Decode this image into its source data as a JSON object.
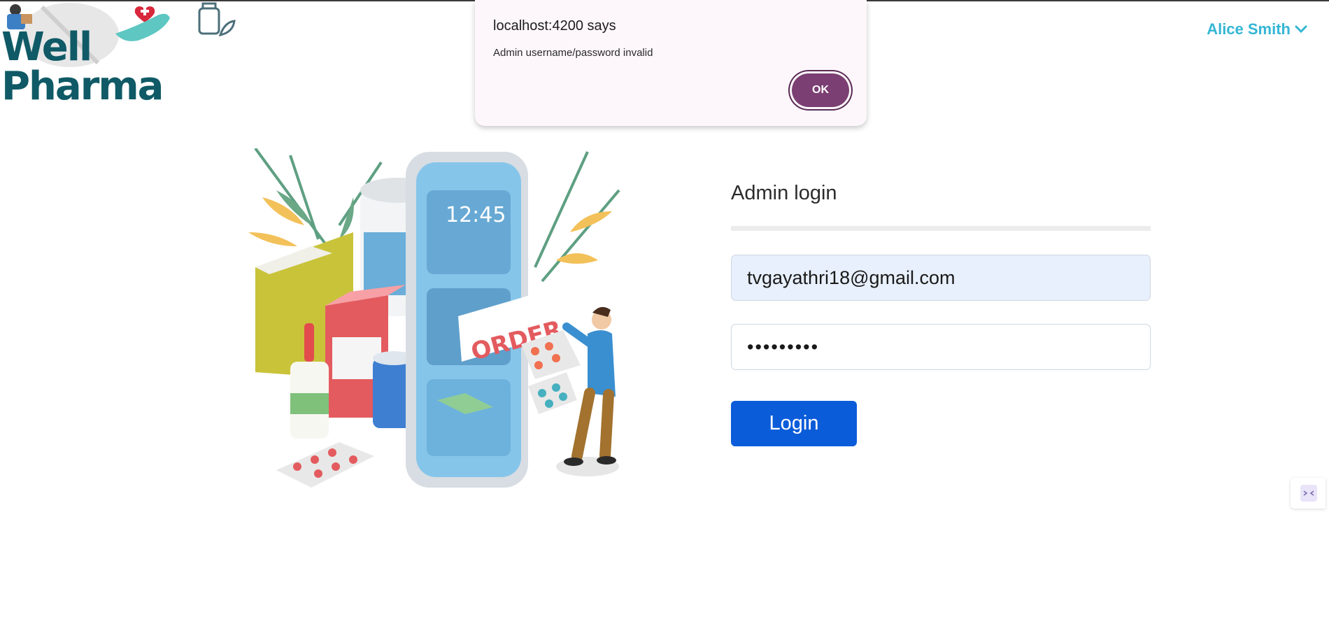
{
  "header": {
    "logo_text": "Well Pharma",
    "user_name": "Alice Smith",
    "user_menu_icon": "chevron-down-icon"
  },
  "alert": {
    "title": "localhost:4200 says",
    "message": "Admin username/password invalid",
    "ok_label": "OK"
  },
  "illustration": {
    "phone_time": "12:45",
    "order_label": "ORDER"
  },
  "login_form": {
    "title": "Admin login",
    "email_value": "tvgayathri18@gmail.com",
    "password_value": "•••••••••",
    "submit_label": "Login"
  },
  "colors": {
    "brand_teal": "#0f5a66",
    "user_accent": "#34b6d4",
    "primary_button": "#0b5cd9",
    "dialog_button": "#7b3f73"
  }
}
